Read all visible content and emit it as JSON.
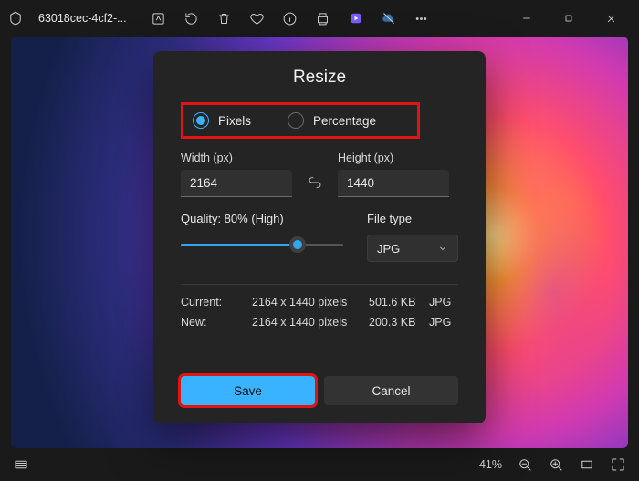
{
  "titlebar": {
    "filename": "63018cec-4cf2-..."
  },
  "dialog": {
    "title": "Resize",
    "unit_pixels": "Pixels",
    "unit_percentage": "Percentage",
    "width_label": "Width  (px)",
    "height_label": "Height  (px)",
    "width_value": "2164",
    "height_value": "1440",
    "quality_label": "Quality: 80% (High)",
    "filetype_label": "File type",
    "filetype_value": "JPG",
    "info": {
      "current_label": "Current:",
      "new_label": "New:",
      "current_dims": "2164 x 1440 pixels",
      "current_size": "501.6 KB",
      "current_fmt": "JPG",
      "new_dims": "2164 x 1440 pixels",
      "new_size": "200.3 KB",
      "new_fmt": "JPG"
    },
    "save": "Save",
    "cancel": "Cancel"
  },
  "statusbar": {
    "zoom": "41%"
  },
  "colors": {
    "accent": "#39b2ff",
    "highlight": "#e11313"
  }
}
